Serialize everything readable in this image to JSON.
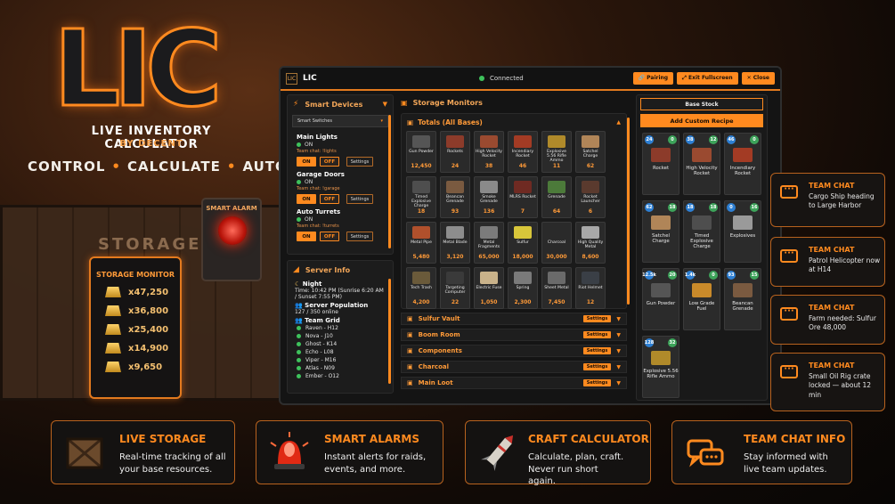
{
  "hero": {
    "logo_text": "LIC",
    "subtitle": "LIVE INVENTORY CALCULATOR",
    "byline": "BY DECENT",
    "tagline": [
      "CONTROL",
      "CALCULATE",
      "AUTOMATE"
    ]
  },
  "scene": {
    "crate_label": "STORAGE",
    "storage_monitor": {
      "title": "STORAGE MONITOR",
      "values": [
        "x47,250",
        "x36,800",
        "x25,400",
        "x14,900",
        "x9,650"
      ]
    },
    "smart_alarm_label": "SMART ALARM"
  },
  "window": {
    "title": "LIC",
    "status": "Connected",
    "buttons": {
      "pairing": "🔗 Pairing",
      "exit_fullscreen": "⤢ Exit Fullscreen",
      "close": "✕ Close"
    }
  },
  "smart_devices": {
    "title": "Smart Devices",
    "filter": "Smart Switches",
    "devices": [
      {
        "name": "Main Lights",
        "status": "ON",
        "chat": "Team chat: !lights",
        "on": "ON",
        "off": "OFF",
        "settings": "Settings"
      },
      {
        "name": "Garage Doors",
        "status": "ON",
        "chat": "Team chat: !garage",
        "on": "ON",
        "off": "OFF",
        "settings": "Settings"
      },
      {
        "name": "Auto Turrets",
        "status": "ON",
        "chat": "Team chat: !turrets",
        "on": "ON",
        "off": "OFF",
        "settings": "Settings"
      }
    ]
  },
  "server_info": {
    "title": "Server Info",
    "time_label": "Night",
    "time_text": "Time: 10:42 PM (Sunrise 6:20 AM / Sunset 7:55 PM)",
    "population_label": "Server Population",
    "population": "127 / 350 online",
    "team_label": "Team Grid",
    "team": [
      "Raven - H12",
      "Nova - J10",
      "Ghost - K14",
      "Echo - L08",
      "Viper - M16",
      "Atlas - N09",
      "Ember - O12"
    ]
  },
  "storage_monitors": {
    "title": "Storage Monitors",
    "totals_title": "Totals (All Bases)",
    "items": [
      {
        "name": "Gun Powder",
        "value": "12,450",
        "color": "#555555"
      },
      {
        "name": "Rockets",
        "value": "24",
        "color": "#8c3b2a"
      },
      {
        "name": "High Velocity Rocket",
        "value": "38",
        "color": "#9a4a30"
      },
      {
        "name": "Incendiary Rocket",
        "value": "46",
        "color": "#a33b24"
      },
      {
        "name": "Explosive 5.56 Rifle Ammo",
        "value": "11",
        "color": "#b08a2a"
      },
      {
        "name": "Satchel Charge",
        "value": "62",
        "color": "#b08558"
      },
      {
        "name": "Timed Explosive Charge",
        "value": "18",
        "color": "#4e4e4e"
      },
      {
        "name": "Beancan Grenade",
        "value": "93",
        "color": "#7a5a40"
      },
      {
        "name": "Smoke Grenade",
        "value": "136",
        "color": "#8a8a8a"
      },
      {
        "name": "MLRS Rocket",
        "value": "7",
        "color": "#6f2a22"
      },
      {
        "name": "Grenade",
        "value": "64",
        "color": "#4c7a3a"
      },
      {
        "name": "Rocket Launcher",
        "value": "6",
        "color": "#5a3a2e"
      },
      {
        "name": "Metal Pipe",
        "value": "5,480",
        "color": "#b0502c"
      },
      {
        "name": "Metal Blade",
        "value": "3,120",
        "color": "#8d8d8d"
      },
      {
        "name": "Metal Fragments",
        "value": "65,000",
        "color": "#7b7b7b"
      },
      {
        "name": "Sulfur",
        "value": "18,000",
        "color": "#d8c63a"
      },
      {
        "name": "Charcoal",
        "value": "30,000",
        "color": "#2a2a2a"
      },
      {
        "name": "High Quality Metal",
        "value": "8,600",
        "color": "#a8a8a8"
      },
      {
        "name": "Tech Trash",
        "value": "4,200",
        "color": "#6a5a3a"
      },
      {
        "name": "Targeting Computer",
        "value": "22",
        "color": "#3a3a3a"
      },
      {
        "name": "Electric Fuse",
        "value": "1,050",
        "color": "#c9b28a"
      },
      {
        "name": "Spring",
        "value": "2,300",
        "color": "#7a7a7a"
      },
      {
        "name": "Sheet Metal",
        "value": "7,450",
        "color": "#6a6a6a"
      },
      {
        "name": "Riot Helmet",
        "value": "12",
        "color": "#3a3f46"
      }
    ],
    "categories": [
      {
        "name": "Sulfur Vault",
        "settings": "Settings"
      },
      {
        "name": "Boom Room",
        "settings": "Settings"
      },
      {
        "name": "Components",
        "settings": "Settings"
      },
      {
        "name": "Charcoal",
        "settings": "Settings"
      },
      {
        "name": "Main Loot",
        "settings": "Settings"
      }
    ]
  },
  "craft": {
    "base_stock": "Base Stock",
    "add_recipe": "Add Custom Recipe",
    "recipes": [
      {
        "name": "Rocket",
        "left": "24",
        "right": "0",
        "color": "#8c3b2a"
      },
      {
        "name": "High Velocity Rocket",
        "left": "38",
        "right": "12",
        "color": "#9a4a30"
      },
      {
        "name": "Incendiary Rocket",
        "left": "46",
        "right": "0",
        "color": "#a33b24"
      },
      {
        "name": "Satchel Charge",
        "left": "62",
        "right": "18",
        "color": "#b08558"
      },
      {
        "name": "Timed Explosive Charge",
        "left": "18",
        "right": "18",
        "color": "#4e4e4e"
      },
      {
        "name": "Explosives",
        "left": "0",
        "right": "16",
        "color": "#9a9a9a"
      },
      {
        "name": "Gun Powder",
        "left": "12.5k",
        "right": "20",
        "color": "#555555"
      },
      {
        "name": "Low Grade Fuel",
        "left": "1.4k",
        "right": "0",
        "color": "#c98a2a"
      },
      {
        "name": "Beancan Grenade",
        "left": "93",
        "right": "15",
        "color": "#7a5a40"
      },
      {
        "name": "Explosive 5.56 Rifle Ammo",
        "left": "128",
        "right": "32",
        "color": "#b08a2a"
      }
    ]
  },
  "team_chat_cards": [
    {
      "title": "TEAM CHAT",
      "text": "Cargo Ship heading to Large Harbor"
    },
    {
      "title": "TEAM CHAT",
      "text": "Patrol Helicopter now at H14"
    },
    {
      "title": "TEAM CHAT",
      "text": "Farm needed: Sulfur Ore 48,000"
    },
    {
      "title": "TEAM CHAT",
      "text": "Small Oil Rig crate locked — about 12 min"
    }
  ],
  "features": [
    {
      "title": "LIVE STORAGE",
      "text": "Real-time tracking of all your base resources."
    },
    {
      "title": "SMART ALARMS",
      "text": "Instant alerts for raids, events, and more."
    },
    {
      "title": "CRAFT CALCULATOR",
      "text": "Calculate, plan, craft. Never run short again."
    },
    {
      "title": "TEAM CHAT INFO",
      "text": "Stay informed with live team updates."
    }
  ],
  "colors": {
    "accent": "#ff8a1f",
    "online": "#3ec25c"
  }
}
